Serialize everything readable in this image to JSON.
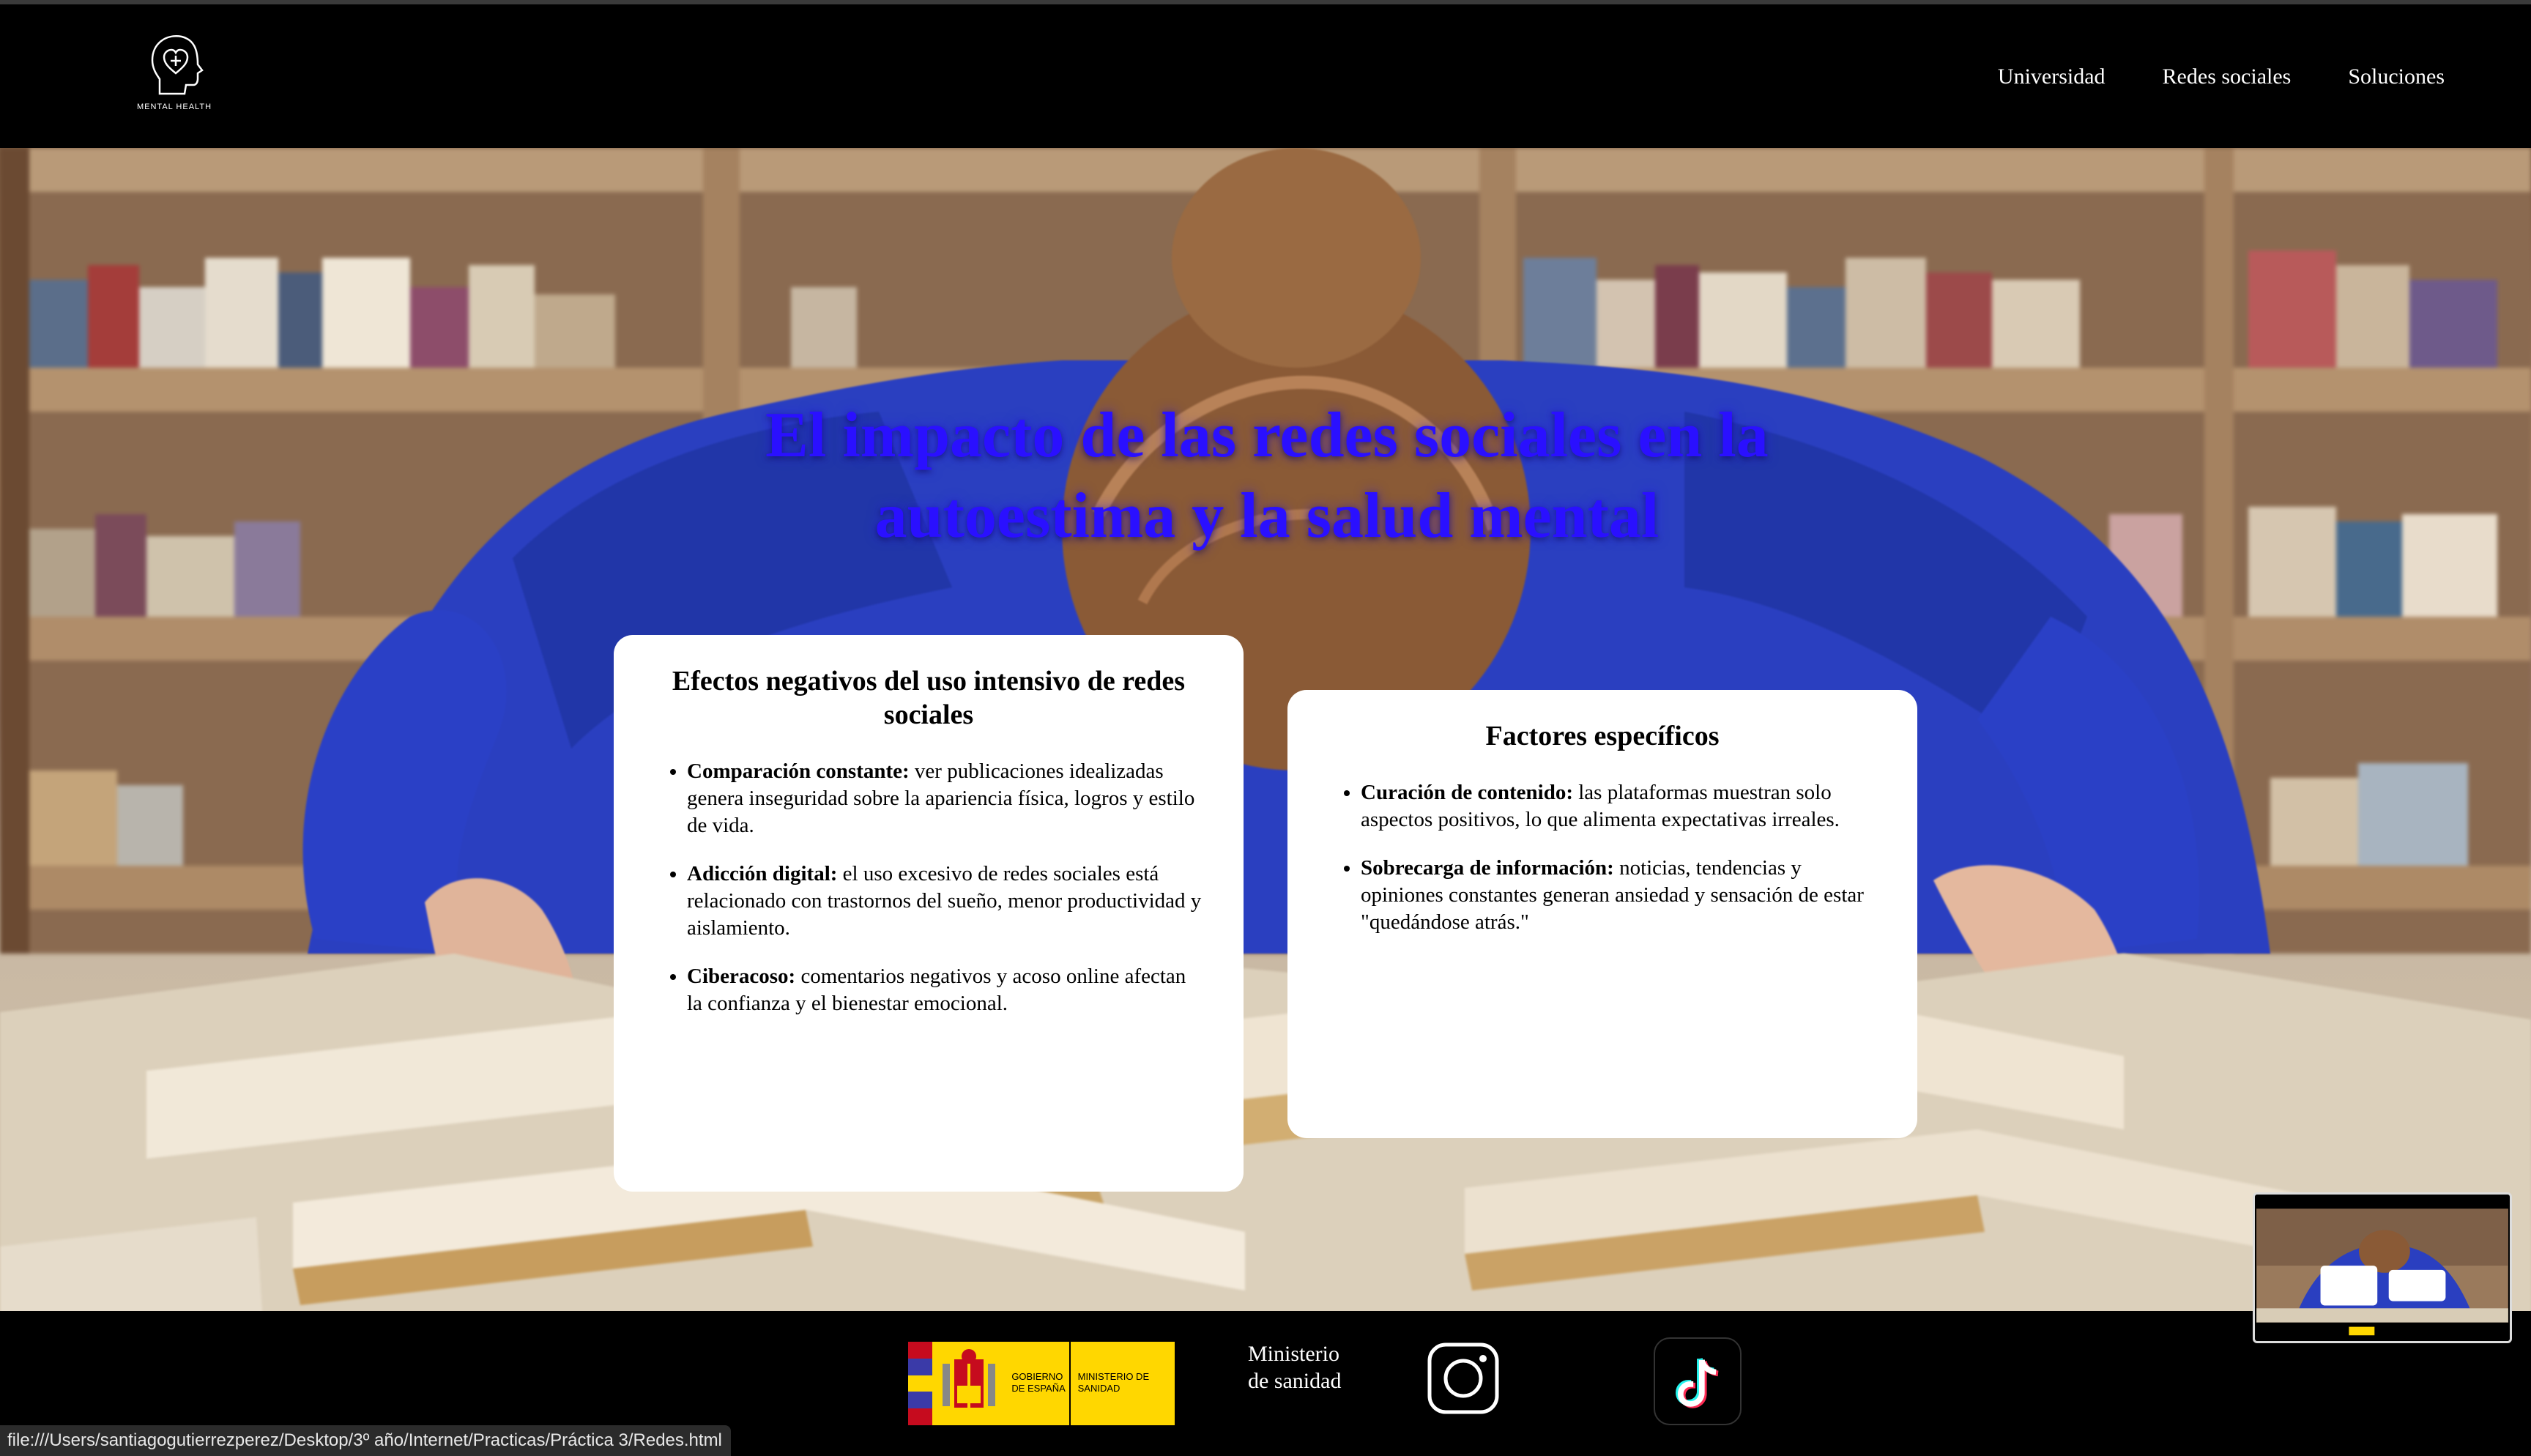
{
  "header": {
    "logo_text": "MENTAL HEALTH",
    "nav": [
      "Universidad",
      "Redes sociales",
      "Soluciones"
    ]
  },
  "hero": {
    "title": "El impacto de las redes sociales en la autoestima y la salud mental"
  },
  "cards": [
    {
      "title": "Efectos negativos del uso intensivo de redes sociales",
      "items": [
        {
          "term": "Comparación constante:",
          "text": " ver publicaciones idealizadas genera inseguridad sobre la apariencia física, logros y estilo de vida."
        },
        {
          "term": "Adicción digital:",
          "text": " el uso excesivo de redes sociales está relacionado con trastornos del sueño, menor productividad y aislamiento."
        },
        {
          "term": "Ciberacoso:",
          "text": " comentarios negativos y acoso online afectan la confianza y el bienestar emocional."
        }
      ]
    },
    {
      "title": "Factores específicos",
      "items": [
        {
          "term": "Curación de contenido:",
          "text": " las plataformas muestran solo aspectos positivos, lo que alimenta expectativas irreales."
        },
        {
          "term": "Sobrecarga de información:",
          "text": " noticias, tendencias y opiniones constantes generan ansiedad y sensación de estar \"quedándose atrás.\""
        }
      ]
    }
  ],
  "footer": {
    "gov_left": "GOBIERNO DE ESPAÑA",
    "gov_right": "MINISTERIO DE SANIDAD",
    "ministry_text": "Ministerio de sanidad",
    "icons": [
      "instagram-icon",
      "tiktok-icon"
    ]
  },
  "status_bar": "file:///Users/santiagogutierrezperez/Desktop/3º  año/Internet/Practicas/Práctica 3/Redes.html",
  "colors": {
    "title_blue": "#2a10ff",
    "header_bg": "#000000",
    "card_bg": "#ffffff",
    "gov_yellow": "#ffd700",
    "gov_red": "#c60b1e"
  }
}
